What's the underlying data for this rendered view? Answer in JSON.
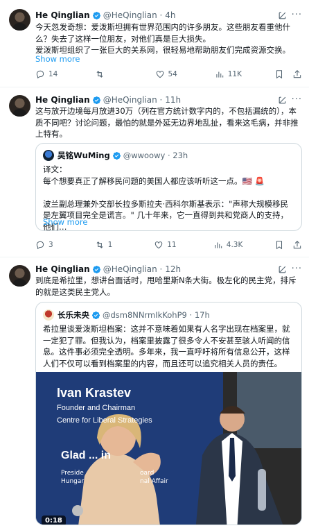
{
  "tweets": [
    {
      "name": "He Qinglian",
      "handle": "@HeQinglian",
      "time": "4h",
      "text": "今天忽发奇想：爱泼斯坦拥有世界范围内的许多朋友。这些朋友看重他什么？失去了这样一位朋友，对他们真是巨大损失。\n爱泼斯坦组织了一张巨大的关系网，很轻易地帮助朋友们完成资源交换。",
      "show_more": "Show more",
      "replies": "14",
      "reposts": "",
      "likes": "54",
      "views": "11K"
    },
    {
      "name": "He Qinglian",
      "handle": "@HeQinglian",
      "time": "11h",
      "text": "这与放开边境每月放进30万（列在官方统计数字内的，不包括漏统的），本质不同吧？讨论问题，最怕的就是外延无边界地乱扯，看来这毛病，并非推上特有。",
      "quote": {
        "name": "吴铭WuMing",
        "handle": "@wwoowy",
        "time": "23h",
        "text": "译文：\n每个想要真正了解移民问题的美国人都应该听听这一点。🇺🇸 🚨\n\n波兰副总理兼外交部长拉多斯拉夫·西科尔斯基表示：\"声称大规模移民是左翼项目完全是谎言。\" 几十年来，它一直得到共和党商人的支持，他们…",
        "show_more": "Show more"
      },
      "replies": "3",
      "reposts": "1",
      "likes": "11",
      "views": "4.3K"
    },
    {
      "name": "He Qinglian",
      "handle": "@HeQinglian",
      "time": "12h",
      "text": "到底是希拉里，想讲台面话时，甩哈里斯N条大街。极左化的民主党，排斥的就是这类民主党人。",
      "quote": {
        "name": "长乐未央",
        "handle": "@dsm8NNrmIkKohP9",
        "time": "17h",
        "text": "希拉里谈爱泼斯坦档案：这并不意味着如果有人名字出现在档案里，就一定犯了罪。但我认为，档案里披露了很多令人不安甚至骇人听闻的信息。这件事必须完全透明。多年来，我一直呼吁将所有信息公开，这样人们不仅可以看到档案里的内容，而且还可以追究相关人员的责任。",
        "video": {
          "banner_name": "Ivan Krastev",
          "banner_title": "Founder and Chairman",
          "banner_org": "Centre for Liberal Strategies",
          "banner2_name": "Glad    ...  in",
          "banner3": "Preside\nHungar",
          "banner3_right": "oard\nnal Affair",
          "duration": "0:18"
        }
      }
    }
  ],
  "colors": {
    "accent": "#1d9bf0",
    "muted": "#536471",
    "border": "#eff3f4"
  },
  "icons": [
    "verified-badge-icon",
    "grok-icon",
    "more-icon",
    "reply-icon",
    "repost-icon",
    "like-icon",
    "views-icon",
    "bookmark-icon",
    "share-icon"
  ]
}
